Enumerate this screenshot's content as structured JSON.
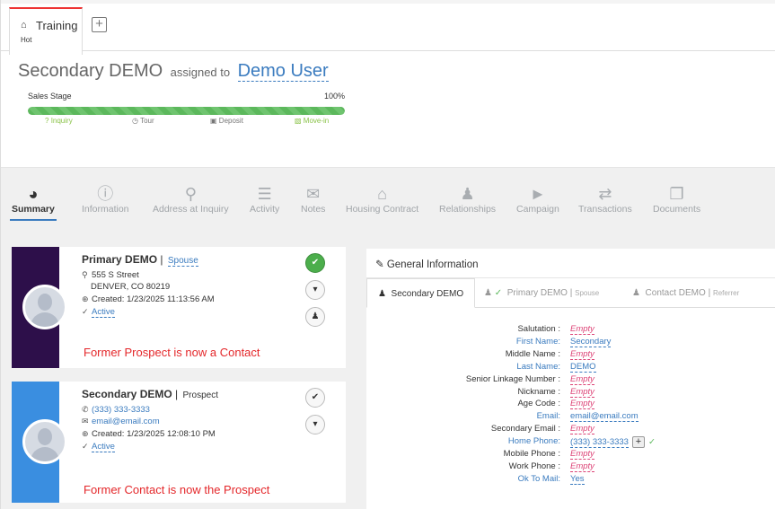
{
  "tabs": {
    "active_label": "Training",
    "active_sub": "Hot"
  },
  "header": {
    "name": "Secondary DEMO",
    "assigned_text": "assigned to",
    "assigned_user": "Demo User"
  },
  "sales_stage": {
    "label": "Sales Stage",
    "percent_text": "100%",
    "progress": 1.0,
    "steps": [
      {
        "label": "Inquiry",
        "icon": "question-icon",
        "color": "#8bc34a"
      },
      {
        "label": "Tour",
        "icon": "clock-icon",
        "color": "#777777"
      },
      {
        "label": "Deposit",
        "icon": "money-icon",
        "color": "#777777"
      },
      {
        "label": "Move-in",
        "icon": "suitcase-icon",
        "color": "#8bc34a"
      }
    ]
  },
  "nav": [
    {
      "label": "Summary",
      "icon": "dashboard-icon",
      "active": true
    },
    {
      "label": "Information",
      "icon": "info-icon"
    },
    {
      "label": "Address at Inquiry",
      "icon": "map-marker-icon"
    },
    {
      "label": "Activity",
      "icon": "list-icon"
    },
    {
      "label": "Notes",
      "icon": "comments-icon"
    },
    {
      "label": "Housing Contract",
      "icon": "home-icon"
    },
    {
      "label": "Relationships",
      "icon": "users-icon"
    },
    {
      "label": "Campaign",
      "icon": "bullhorn-icon"
    },
    {
      "label": "Transactions",
      "icon": "exchange-icon"
    },
    {
      "label": "Documents",
      "icon": "files-icon"
    }
  ],
  "cards": [
    {
      "name": "Primary DEMO",
      "sep": "|",
      "relation": "Spouse",
      "address1": "555 S Street",
      "address2": "DENVER, CO 80219",
      "created": "Created: 1/23/2025 11:13:56 AM",
      "status": "Active",
      "note": "Former Prospect is now a Contact",
      "band_color": "#2d0f4a"
    },
    {
      "name": "Secondary DEMO",
      "sep": "|",
      "relation": "Prospect",
      "phone": "(333) 333-3333",
      "email": "email@email.com",
      "created": "Created: 1/23/2025 12:08:10 PM",
      "status": "Active",
      "note": "Former Contact is now the Prospect",
      "band_color": "#3a8ee0"
    }
  ],
  "general": {
    "title": "General Information",
    "tabs": [
      {
        "label": "Secondary DEMO",
        "sub": "",
        "active": true
      },
      {
        "label": "Primary DEMO",
        "sub": "Spouse",
        "sep": "|"
      },
      {
        "label": "Contact DEMO",
        "sub": "Referrer",
        "sep": "|"
      }
    ],
    "fields": [
      {
        "label": "Salutation :",
        "value": "Empty",
        "empty": true,
        "blue": false
      },
      {
        "label": "First Name:",
        "value": "Secondary",
        "empty": false,
        "blue": true
      },
      {
        "label": "Middle Name :",
        "value": "Empty",
        "empty": true,
        "blue": false
      },
      {
        "label": "Last Name:",
        "value": "DEMO",
        "empty": false,
        "blue": true
      },
      {
        "label": "Senior Linkage Number :",
        "value": "Empty",
        "empty": true,
        "blue": false
      },
      {
        "label": "Nickname :",
        "value": "Empty",
        "empty": true,
        "blue": false
      },
      {
        "label": "Age Code :",
        "value": "Empty",
        "empty": true,
        "blue": false
      },
      {
        "label": "Email:",
        "value": "email@email.com",
        "empty": false,
        "blue": true
      },
      {
        "label": "Secondary Email :",
        "value": "Empty",
        "empty": true,
        "blue": false
      },
      {
        "label": "Home Phone:",
        "value": "(333) 333-3333",
        "empty": false,
        "blue": true,
        "plus": true
      },
      {
        "label": "Mobile Phone :",
        "value": "Empty",
        "empty": true,
        "blue": false
      },
      {
        "label": "Work Phone :",
        "value": "Empty",
        "empty": true,
        "blue": false
      },
      {
        "label": "Ok To Mail:",
        "value": "Yes",
        "empty": false,
        "blue": true
      }
    ]
  }
}
